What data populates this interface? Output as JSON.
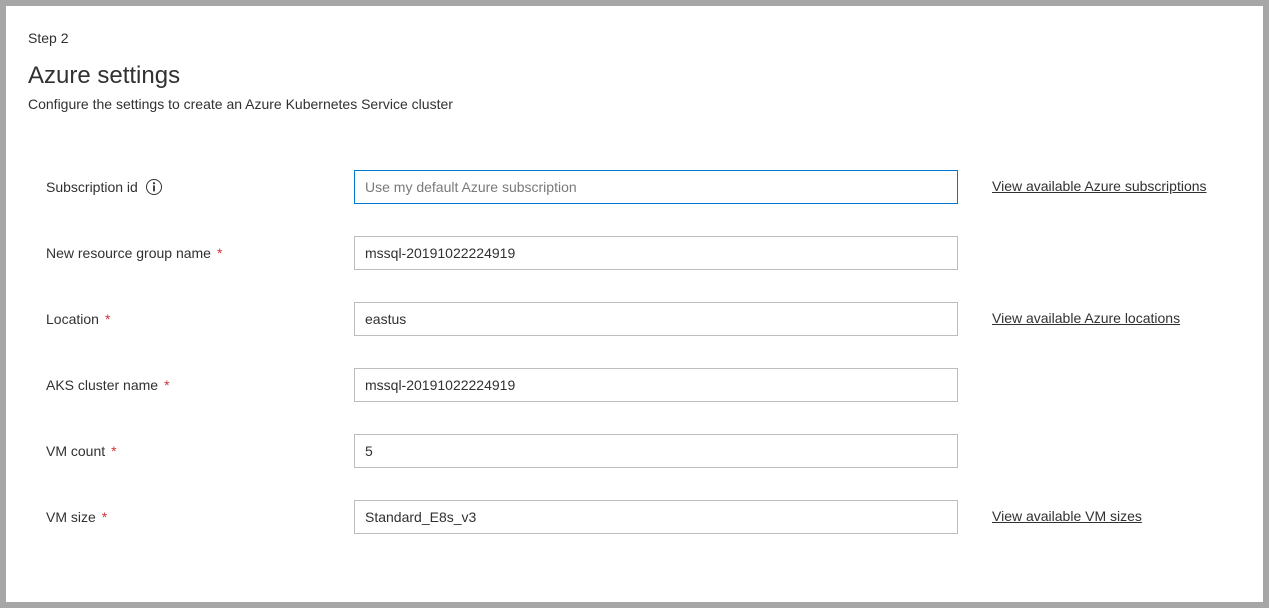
{
  "step_label": "Step 2",
  "title": "Azure settings",
  "subtitle": "Configure the settings to create an Azure Kubernetes Service cluster",
  "fields": {
    "subscription_id": {
      "label": "Subscription id",
      "placeholder": "Use my default Azure subscription",
      "value": "",
      "link_text": "View available Azure subscriptions"
    },
    "resource_group": {
      "label": "New resource group name",
      "value": "mssql-20191022224919"
    },
    "location": {
      "label": "Location",
      "value": "eastus",
      "link_text": "View available Azure locations"
    },
    "aks_cluster": {
      "label": "AKS cluster name",
      "value": "mssql-20191022224919"
    },
    "vm_count": {
      "label": "VM count",
      "value": "5"
    },
    "vm_size": {
      "label": "VM size",
      "value": "Standard_E8s_v3",
      "link_text": "View available VM sizes"
    }
  }
}
